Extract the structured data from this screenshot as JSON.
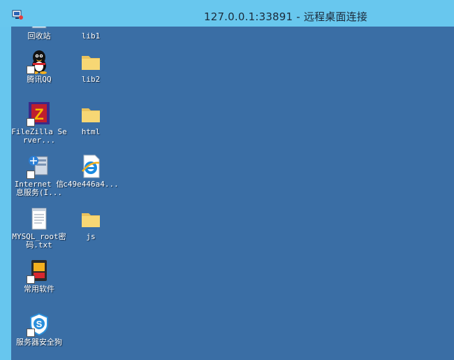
{
  "window": {
    "title": "127.0.0.1:33891 - 远程桌面连接",
    "icon": "remote-desktop-icon"
  },
  "desktop": {
    "icons": [
      {
        "label": "回收站",
        "icon": "recycle-bin-icon",
        "shortcut": false
      },
      {
        "label": "lib1",
        "icon": "folder-icon",
        "shortcut": false
      },
      {
        "label": "腾讯QQ",
        "icon": "qq-penguin-icon",
        "shortcut": true
      },
      {
        "label": "lib2",
        "icon": "folder-icon",
        "shortcut": false
      },
      {
        "label": "FileZilla Server...",
        "icon": "filezilla-server-icon",
        "shortcut": true
      },
      {
        "label": "html",
        "icon": "folder-icon",
        "shortcut": false
      },
      {
        "label": "Internet 信息服务(I...",
        "icon": "iis-manager-icon",
        "shortcut": true
      },
      {
        "label": "c49e446a4...",
        "icon": "internet-explorer-icon",
        "shortcut": false
      },
      {
        "label": "MYSQL_root密码.txt",
        "icon": "text-file-icon",
        "shortcut": false
      },
      {
        "label": "js",
        "icon": "folder-icon",
        "shortcut": false
      },
      {
        "label": "常用软件",
        "icon": "software-folder-icon",
        "shortcut": true
      },
      {
        "label": "服务器安全狗",
        "icon": "safedog-icon",
        "shortcut": true
      }
    ]
  },
  "colors": {
    "titlebar": "#68c7ee",
    "desktop": "#3a6ea5",
    "folder": "#f7d774"
  }
}
